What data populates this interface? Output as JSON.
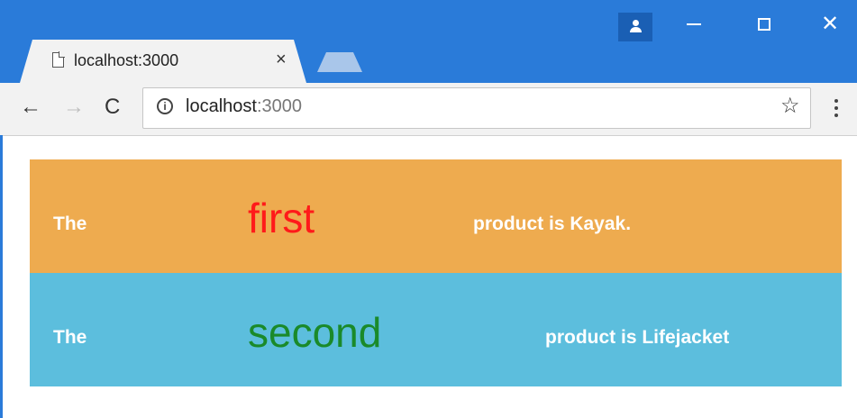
{
  "browser": {
    "tab_title": "localhost:3000",
    "tab_close": "×",
    "url_host": "localhost",
    "url_port": ":3000",
    "back": "←",
    "forward": "→",
    "reload": "C",
    "star": "☆",
    "info": "i",
    "window_close": "✕"
  },
  "rows": [
    {
      "prefix": "The",
      "ordinal": "first",
      "ordinal_color": "#ff1a1a",
      "suffix": "product is Kayak.",
      "background": "#eeab4f"
    },
    {
      "prefix": "The",
      "ordinal": "second",
      "ordinal_color": "#1a8a2a",
      "suffix": "product is Lifejacket",
      "background": "#5cbedd"
    }
  ]
}
